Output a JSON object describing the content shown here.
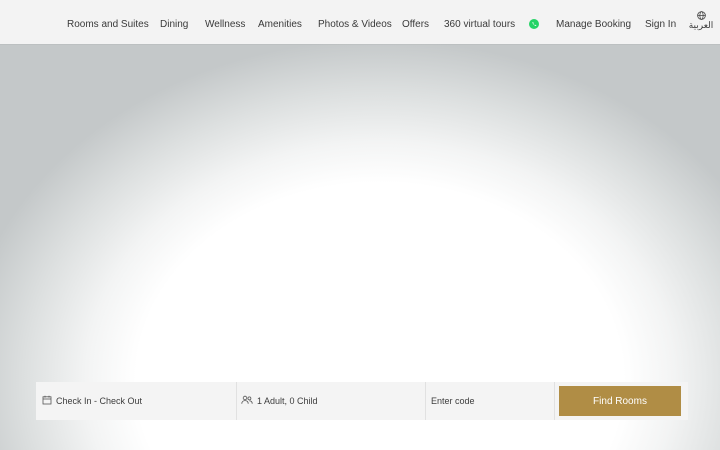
{
  "nav": {
    "items": [
      {
        "label": "Rooms and Suites"
      },
      {
        "label": "Dining"
      },
      {
        "label": "Wellness"
      },
      {
        "label": "Amenities"
      },
      {
        "label": "Photos & Videos"
      },
      {
        "label": "Offers"
      },
      {
        "label": "360 virtual tours"
      }
    ],
    "whatsapp_icon": "whatsapp-icon",
    "manage_booking": "Manage Booking",
    "sign_in": "Sign In",
    "language": "العربية",
    "language_icon": "globe-icon"
  },
  "booking": {
    "dates_label": "Check In - Check Out",
    "dates_icon": "calendar-icon",
    "guests_label": "1 Adult, 0 Child",
    "guests_icon": "users-icon",
    "promo_placeholder": "Enter code",
    "find_button": "Find Rooms"
  },
  "colors": {
    "accent": "#b08d45",
    "whatsapp": "#25d366",
    "header_bg": "#f3f3f3"
  }
}
